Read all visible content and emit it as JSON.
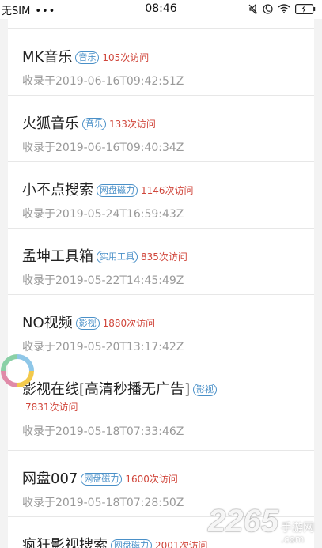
{
  "status_bar": {
    "carrier": "无SIM",
    "dots": "•••",
    "time": "08:46"
  },
  "items": [
    {
      "name": "MK音乐",
      "tag": "音乐",
      "visits": "105次访问",
      "date": "收录于2019-06-16T09:42:51Z"
    },
    {
      "name": "火狐音乐",
      "tag": "音乐",
      "visits": "133次访问",
      "date": "收录于2019-06-16T09:40:34Z"
    },
    {
      "name": "小不点搜索",
      "tag": "网盘磁力",
      "visits": "1146次访问",
      "date": "收录于2019-05-24T16:59:43Z"
    },
    {
      "name": "孟坤工具箱",
      "tag": "实用工具",
      "visits": "835次访问",
      "date": "收录于2019-05-22T14:45:49Z"
    },
    {
      "name": "NO视频",
      "tag": "影视",
      "visits": "1880次访问",
      "date": "收录于2019-05-20T13:17:42Z"
    },
    {
      "name": "影视在线[高清秒播无广告]",
      "tag": "影视",
      "visits": "7831次访问",
      "date": "收录于2019-05-18T07:33:46Z"
    },
    {
      "name": "网盘007",
      "tag": "网盘磁力",
      "visits": "1600次访问",
      "date": "收录于2019-05-18T07:28:50Z"
    },
    {
      "name": "疯狂影视搜索",
      "tag": "网盘磁力",
      "visits": "2001次访问",
      "date": ""
    }
  ],
  "watermark": {
    "number": "2265",
    "suffix": "手游网",
    "domain": ".com"
  },
  "colors": {
    "tag": "#4a90c8",
    "visits": "#d0463b",
    "date": "#9a9a9a",
    "title": "#222222"
  }
}
